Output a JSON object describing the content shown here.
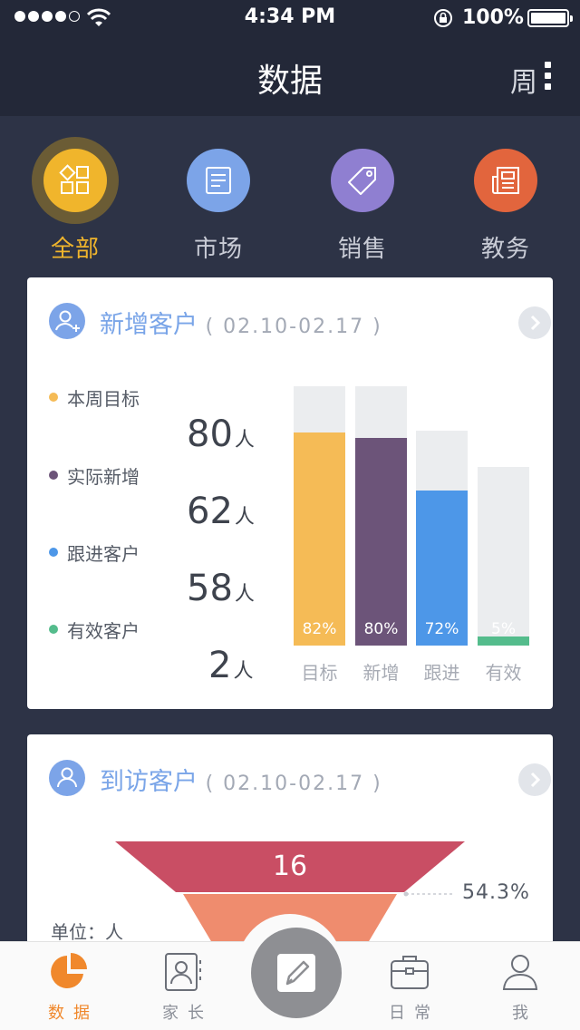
{
  "status_bar": {
    "time": "4:34 PM",
    "battery": "100%"
  },
  "nav": {
    "title": "数据",
    "period": "周"
  },
  "categories": [
    {
      "label": "全部",
      "icon": "grid-icon",
      "color": "#f0b52c",
      "active": true
    },
    {
      "label": "市场",
      "icon": "document-icon",
      "color": "#7ca4e8"
    },
    {
      "label": "销售",
      "icon": "tag-icon",
      "color": "#8f7fd1"
    },
    {
      "label": "教务",
      "icon": "newspaper-icon",
      "color": "#e2653d"
    }
  ],
  "card_new_customers": {
    "title": "新增客户",
    "range": "( 02.10-02.17 )",
    "legend": [
      {
        "label": "本周目标",
        "color": "#f5bb56",
        "value": "80",
        "unit": "人"
      },
      {
        "label": "实际新增",
        "color": "#6c5479",
        "value": "62",
        "unit": "人"
      },
      {
        "label": "跟进客户",
        "color": "#4d97e8",
        "value": "58",
        "unit": "人"
      },
      {
        "label": "有效客户",
        "color": "#54bc8c",
        "value": "2",
        "unit": "人"
      }
    ],
    "chart_data": {
      "type": "bar",
      "categories": [
        "目标",
        "新增",
        "跟进",
        "有效"
      ],
      "values": [
        82,
        80,
        72,
        5
      ],
      "value_labels": [
        "82%",
        "80%",
        "72%",
        "5%"
      ],
      "colors": [
        "#f5bb56",
        "#6c5479",
        "#4d97e8",
        "#54bc8c"
      ]
    }
  },
  "card_visits": {
    "title": "到访客户",
    "range": "( 02.10-02.17 )",
    "funnel_top_value": "16",
    "conversion": "54.3%",
    "unit_label": "单位：人",
    "funnel_colors": [
      "#c94e64",
      "#ef8c6e"
    ]
  },
  "tabbar": {
    "items": [
      {
        "label": "数据",
        "icon": "pie-chart-icon",
        "active": true
      },
      {
        "label": "家长",
        "icon": "contact-card-icon"
      },
      {
        "label": "日常",
        "icon": "briefcase-icon"
      },
      {
        "label": "我",
        "icon": "user-icon"
      }
    ],
    "compose_icon": "compose-icon"
  }
}
